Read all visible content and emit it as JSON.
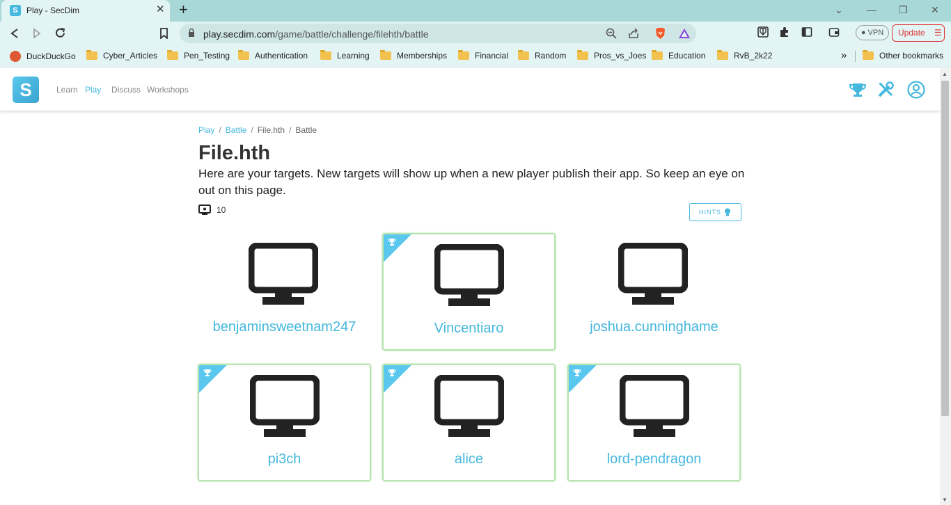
{
  "browser": {
    "tab_title": "Play - SecDim",
    "tab_favicon_letter": "S",
    "url_host": "play.secdim.com",
    "url_path": "/game/battle/challenge/fileht​h/battle",
    "vpn_label": "VPN",
    "update_label": "Update",
    "bookmarks": [
      "DuckDuckGo",
      "Cyber_Articles",
      "Pen_Testing",
      "Authentication",
      "Learning",
      "Memberships",
      "Financial",
      "Random",
      "Pros_vs_Joes",
      "Education",
      "RvB_2k22"
    ],
    "other_bookmarks": "Other bookmarks",
    "overflow": "»"
  },
  "site": {
    "logo_letter": "S",
    "nav": [
      "Learn",
      "Play",
      "Discuss",
      "Workshops"
    ],
    "active_nav": "Play"
  },
  "breadcrumb": {
    "items": [
      "Play",
      "Battle",
      "File.hth",
      "Battle"
    ]
  },
  "page": {
    "title": "File.hth",
    "description": "Here are your targets. New targets will show up when a new player publish their app. So keep an eye on out on this page.",
    "target_count": "10",
    "hints_label": "HINTS"
  },
  "targets": [
    {
      "name": "benjaminsweetnam247",
      "solved": false
    },
    {
      "name": "Vincentiaro",
      "solved": true
    },
    {
      "name": "joshua.cunninghame",
      "solved": false
    },
    {
      "name": "pi3ch",
      "solved": true
    },
    {
      "name": "alice",
      "solved": true
    },
    {
      "name": "lord-pendragon",
      "solved": true
    }
  ],
  "colors": {
    "accent": "#45b8de",
    "solved_border": "#b8e4b0",
    "chrome": "#a8d8d8"
  }
}
